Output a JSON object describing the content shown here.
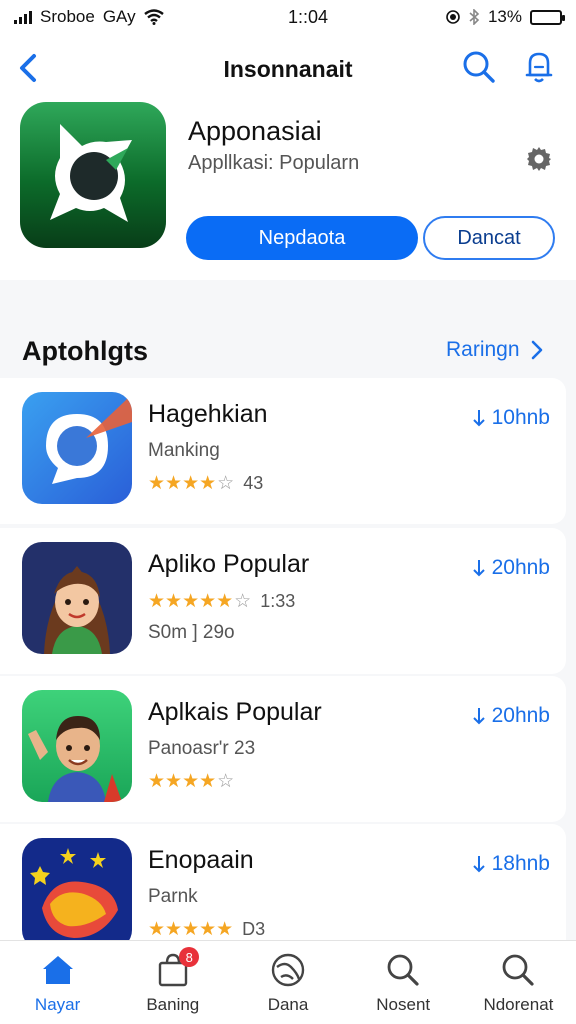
{
  "status_bar": {
    "carrier": "Sroboe",
    "network": "GAy",
    "time": "1::04",
    "battery": "13%",
    "battery_level": 0.13
  },
  "nav": {
    "title": "Insonnanait",
    "back_icon": "chevron-left-icon",
    "search_icon": "search-icon",
    "bell_icon": "bell-icon"
  },
  "app": {
    "name": "Apponasiai",
    "subtitle": "Appllkasi: Popularn",
    "primary_button": "Nepdaota",
    "secondary_button": "Dancat",
    "settings_icon": "gear-icon"
  },
  "section": {
    "title": "Aptohlgts",
    "link": "Raringn"
  },
  "apps": [
    {
      "title": "Hagehkian",
      "line1": "Manking",
      "rating": 4,
      "rating_text": "43",
      "line2": "",
      "download": "10hnb",
      "icon": "chat-bubble-icon"
    },
    {
      "title": "Apliko Popular",
      "line1": "",
      "rating": 4.5,
      "rating_text": "1:33",
      "line2": "S0m ] 29o",
      "download": "20hnb",
      "icon": "woman-avatar-icon"
    },
    {
      "title": "Aplkais Popular",
      "line1": "Panoasr'r 23",
      "rating": 4,
      "rating_text": "",
      "line2": "",
      "download": "20hnb",
      "icon": "man-avatar-icon"
    },
    {
      "title": "Enopaain",
      "line1": "Parnk",
      "rating": 5,
      "rating_text": "D3",
      "line2": "",
      "download": "18hnb",
      "icon": "stars-game-icon"
    }
  ],
  "tabs": [
    {
      "label": "Nayar",
      "icon": "home-icon",
      "active": true,
      "badge": ""
    },
    {
      "label": "Baning",
      "icon": "shopping-bag-icon",
      "active": false,
      "badge": "8"
    },
    {
      "label": "Dana",
      "icon": "globe-icon",
      "active": false,
      "badge": ""
    },
    {
      "label": "Nosent",
      "icon": "search-icon",
      "active": false,
      "badge": ""
    },
    {
      "label": "Ndorenat",
      "icon": "search-icon",
      "active": false,
      "badge": ""
    }
  ],
  "colors": {
    "accent": "#1a6fe8",
    "primary_button": "#0a6cf5",
    "star": "#f5a623",
    "badge": "#e8313a"
  }
}
